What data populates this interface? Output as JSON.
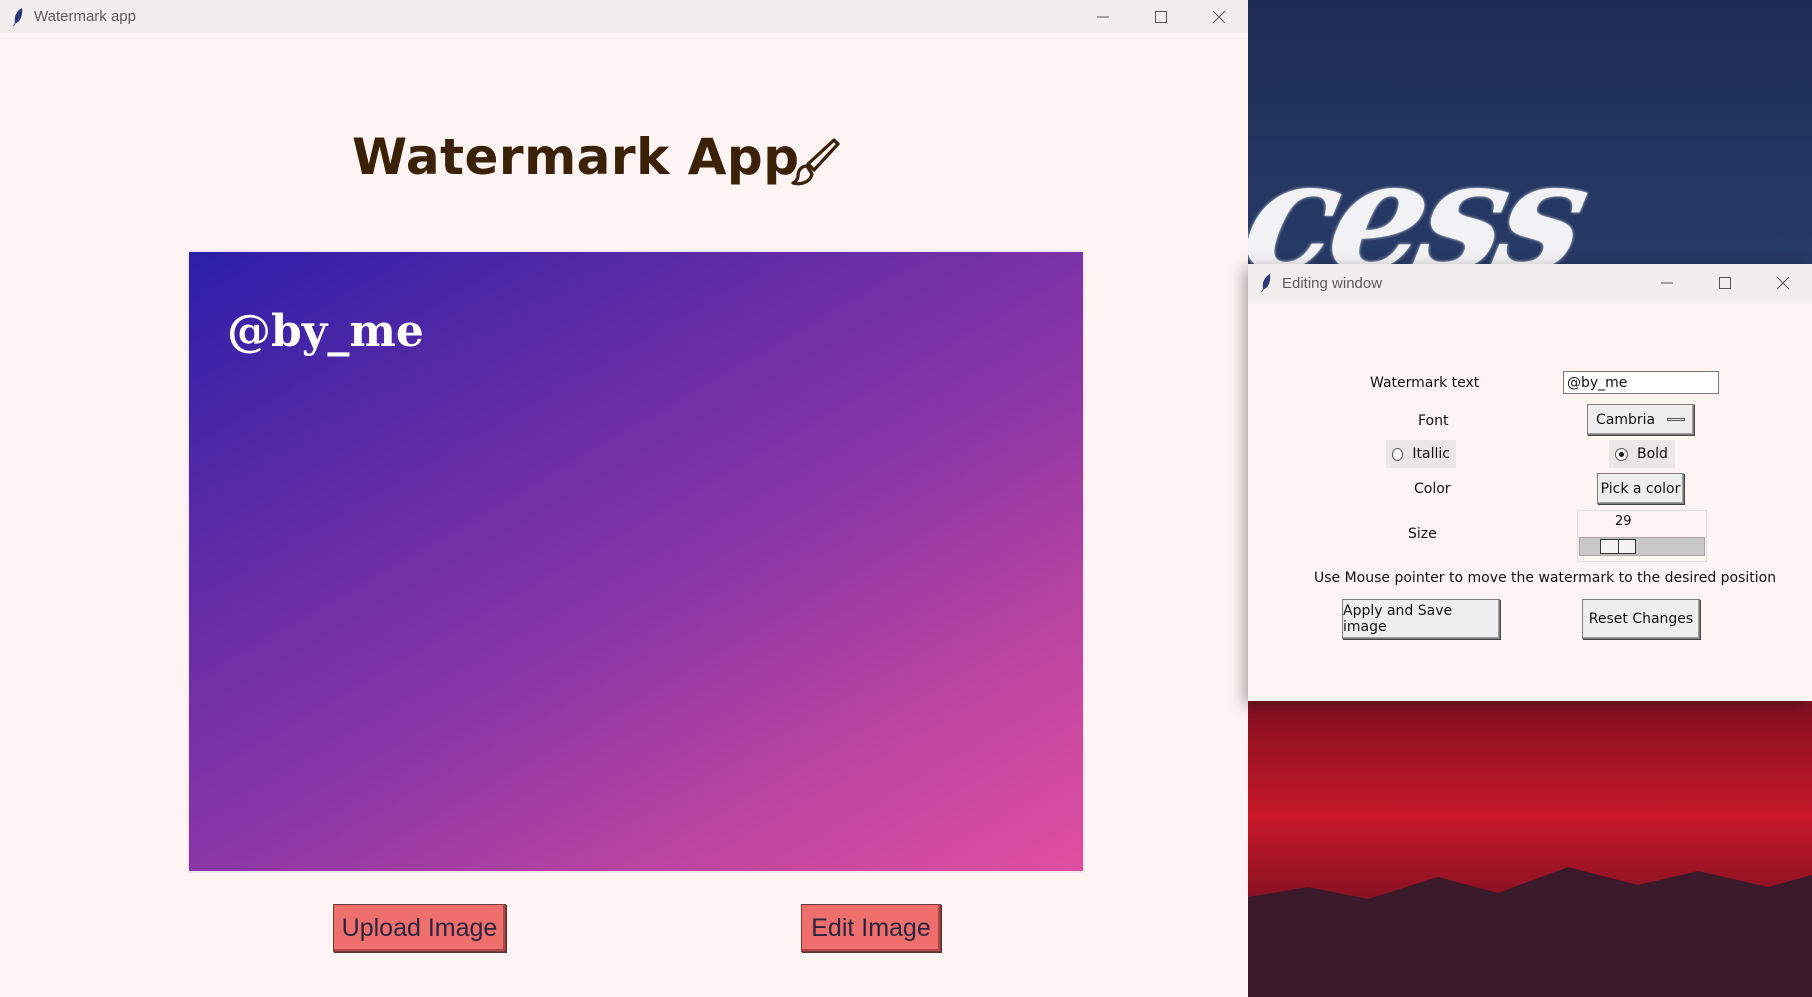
{
  "main_window": {
    "title": "Watermark app",
    "heading": "Watermark App",
    "heading_icon": "paintbrush-icon",
    "watermark_preview_text": "@by_me",
    "upload_button": "Upload Image",
    "edit_button": "Edit Image"
  },
  "edit_window": {
    "title": "Editing window",
    "watermark_text_label": "Watermark text",
    "watermark_text_value": "@by_me",
    "font_label": "Font",
    "font_value": "Cambria",
    "italic_label": "Itallic",
    "italic_checked": false,
    "bold_label": "Bold",
    "bold_checked": true,
    "color_label": "Color",
    "color_button": "Pick a color",
    "size_label": "Size",
    "size_value": "29",
    "hint": "Use Mouse pointer to move the watermark to the desired position",
    "apply_button": "Apply and Save image",
    "reset_button": "Reset Changes"
  },
  "colors": {
    "window_bg": "#fef4f3",
    "button_red": "#ee6f6c",
    "heading": "#3a2108",
    "gradient_start": "#2a1fa8",
    "gradient_end": "#e04ea0"
  }
}
